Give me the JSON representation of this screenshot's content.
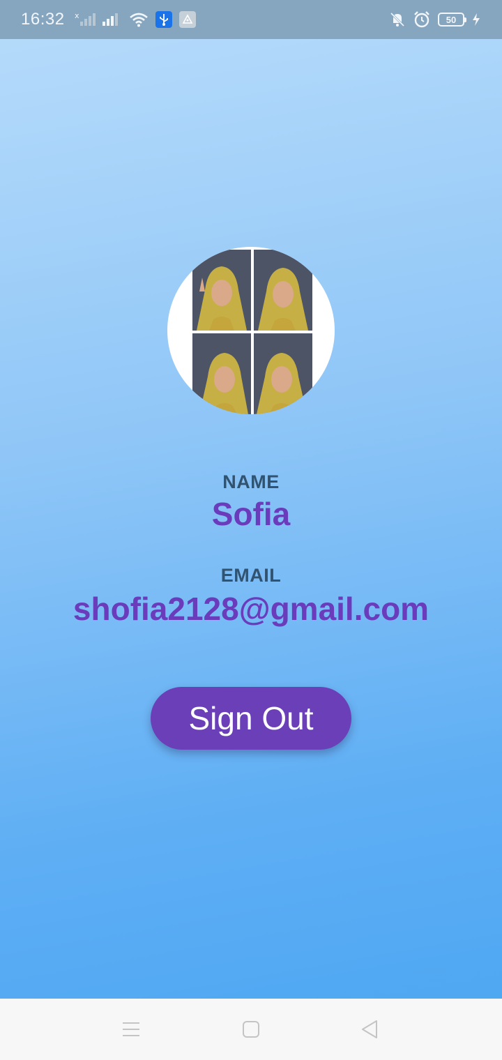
{
  "status_bar": {
    "time": "16:32",
    "battery_level": "50",
    "icons": [
      "no-signal-sim-icon",
      "signal-icon",
      "wifi-icon",
      "usb-icon",
      "app-notification-icon",
      "notifications-off-icon",
      "alarm-icon",
      "battery-icon",
      "charging-icon"
    ]
  },
  "profile": {
    "name_label": "NAME",
    "name": "Sofia",
    "email_label": "EMAIL",
    "email": "shofia2128@gmail.com"
  },
  "actions": {
    "sign_out_label": "Sign Out"
  },
  "colors": {
    "accent": "#6a3fb8",
    "value_text": "#6a3cbc",
    "label_text": "#32536f",
    "background_top": "#b8dcfb",
    "background_bottom": "#4ba6f2"
  },
  "nav_bar": {
    "icons": [
      "menu-icon",
      "home-icon",
      "back-icon"
    ]
  }
}
